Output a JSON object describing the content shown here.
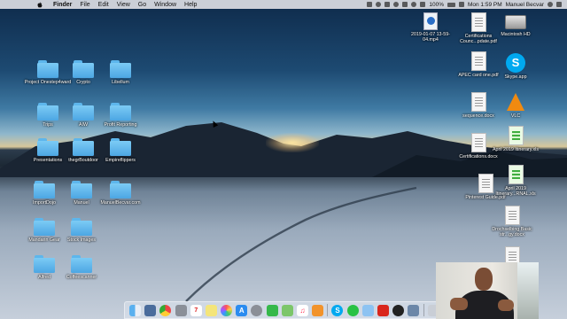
{
  "menubar": {
    "items": [
      "Finder",
      "File",
      "Edit",
      "View",
      "Go",
      "Window",
      "Help"
    ],
    "battery": "100%",
    "clock": "Mon 1:59 PM",
    "user": "Manuel Becvar"
  },
  "left_folders": [
    {
      "label": "Project Onestep4ward"
    },
    {
      "label": "Crypto"
    },
    {
      "label": "Libellum"
    },
    {
      "label": "Trips"
    },
    {
      "label": "AIW"
    },
    {
      "label": "Profit Reporting"
    },
    {
      "label": "Presentations"
    },
    {
      "label": "thegrBoutdoor"
    },
    {
      "label": "Empireflippers"
    },
    {
      "label": "ImportDojo"
    },
    {
      "label": "Manuel"
    },
    {
      "label": "ManuelBecvar.com"
    },
    {
      "label": "Mandarin Gear"
    },
    {
      "label": "Stock Images"
    },
    {
      "label": "Alfred"
    },
    {
      "label": "Coffeescanner"
    }
  ],
  "right_files": {
    "video": "2019-01-07 13-59-04.mp4",
    "cert_pdf": "Certifications Counc...pdate.pdf",
    "hd": "Macintosh HD",
    "apec": "APEC card one.pdf",
    "skype": "Skype.app",
    "sequence": "sequence.docx",
    "vlc": "VLC",
    "cert_docx": "Certifications.docx",
    "itinerary1": "April 2019 Itinerary.xls",
    "pinterest": "Pinterest Guide.pdf",
    "itinerary2": "April 2019 Itinerary...RNAL.xls",
    "drochsel": "Drochselbing Basic str...gy.docx"
  },
  "dock": [
    "finder",
    "launchpad",
    "chrome",
    "rocket",
    "calendar",
    "notes",
    "photos",
    "appstore",
    "preferences",
    "facetime",
    "maps",
    "music",
    "ibooks",
    "skype",
    "whatsapp",
    "photos2",
    "acrobat",
    "quicktime",
    "keynote",
    "trash"
  ]
}
